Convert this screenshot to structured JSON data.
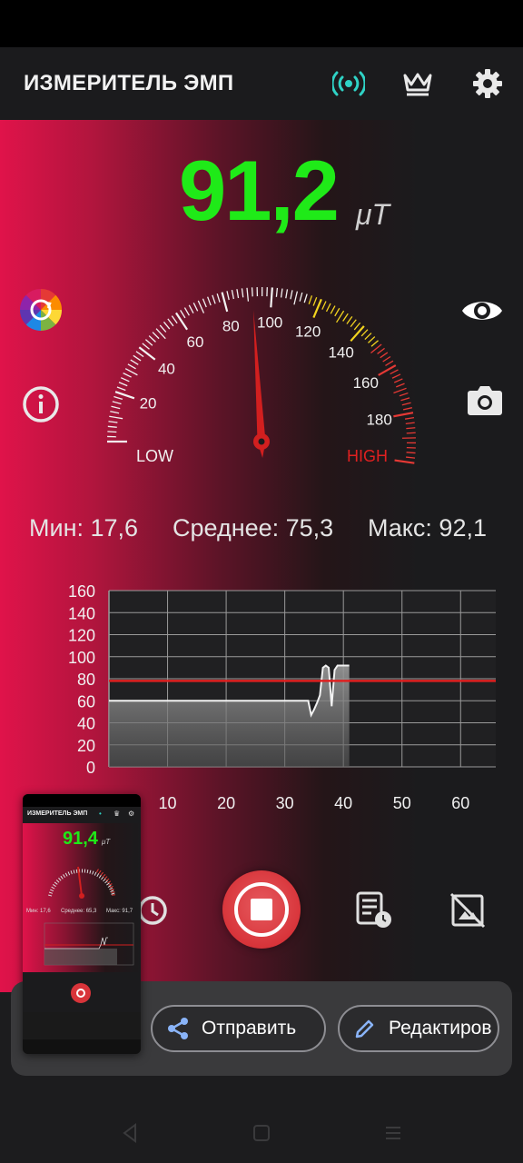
{
  "app": {
    "title": "ИЗМЕРИТЕЛЬ ЭМП",
    "icons": [
      "broadcast-icon",
      "crown-icon",
      "gear-icon"
    ],
    "accent": "#1fea18",
    "danger": "#e02020"
  },
  "reading": {
    "value": "91,2",
    "unit": "μT"
  },
  "gauge": {
    "labels": [
      "20",
      "40",
      "60",
      "80",
      "100",
      "120",
      "140",
      "160",
      "180"
    ],
    "low_label": "LOW",
    "high_label": "HIGH",
    "needle_value": 92
  },
  "stats": {
    "min": "Мин: 17,6",
    "avg": "Среднее: 75,3",
    "max": "Макс: 92,1"
  },
  "chart_data": {
    "type": "line",
    "y_ticks": [
      "160",
      "140",
      "120",
      "100",
      "80",
      "60",
      "40",
      "20",
      "0"
    ],
    "x_ticks": [
      "10",
      "20",
      "30",
      "40",
      "50",
      "60"
    ],
    "ylim": [
      0,
      160
    ],
    "xlim": [
      0,
      66
    ],
    "threshold": 78,
    "grid": true,
    "series": [
      {
        "x": [
          0,
          4,
          8,
          12,
          16,
          20,
          24,
          28,
          32,
          34,
          34.5,
          35,
          35.5,
          36,
          36.5,
          37,
          37.5,
          38,
          38.5,
          39,
          40,
          41
        ],
        "y": [
          60,
          60,
          60,
          60,
          60,
          60,
          60,
          60,
          60,
          60,
          47,
          52,
          58,
          65,
          90,
          92,
          90,
          55,
          88,
          92,
          92,
          92
        ]
      }
    ]
  },
  "thumbnail": {
    "title": "ИЗМЕРИТЕЛЬ ЭМП",
    "reading": "91,4",
    "unit": "μT",
    "stats": [
      "Мин: 17,6",
      "Среднее: 65,3",
      "Макс: 91,7"
    ]
  },
  "share": {
    "send_label": "Отправить",
    "edit_label": "Редактиров"
  }
}
